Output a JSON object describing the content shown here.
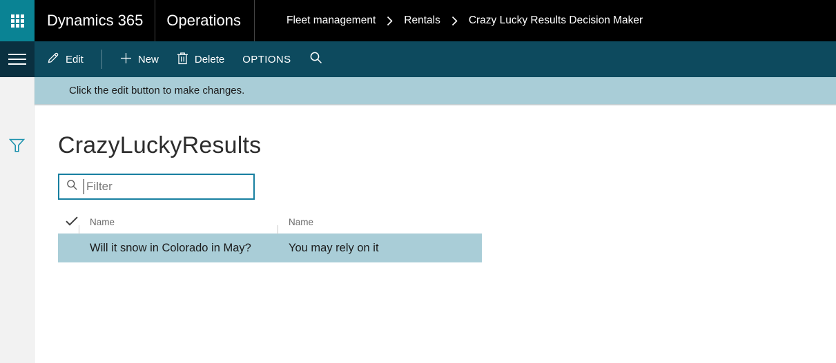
{
  "app": {
    "product": "Dynamics 365",
    "suite": "Operations"
  },
  "breadcrumb": {
    "items": [
      "Fleet management",
      "Rentals",
      "Crazy Lucky Results Decision Maker"
    ]
  },
  "toolbar": {
    "edit": "Edit",
    "new": "New",
    "delete": "Delete",
    "options": "OPTIONS"
  },
  "notification": {
    "message": "Click the edit button to make changes."
  },
  "page": {
    "title": "CrazyLuckyResults",
    "filter_placeholder": "Filter"
  },
  "grid": {
    "columns": [
      "Name",
      "Name"
    ],
    "rows": [
      {
        "name": "Will it snow in Colorado in May?",
        "value": "You may rely on it",
        "selected": true
      }
    ]
  },
  "icons": {
    "waffle-icon": "3x3-grid",
    "hamburger-icon": "≡",
    "edit-pencil-icon": "✎",
    "plus-icon": "+",
    "trash-icon": "🗑",
    "toolbar-search-icon": "🔍",
    "filter-funnel-icon": "⧩",
    "input-search-icon": "🔍",
    "select-all-checkmark-icon": "✓",
    "breadcrumb-chevron-icon": "›",
    "text-caret": "|"
  },
  "colors": {
    "topbar": "#000000",
    "brand_teal": "#0a8394",
    "toolbar": "#0d4a5e",
    "toolbar_nav_strip": "#0a3040",
    "notification": "#a9cdd7",
    "row_selection": "#a9cdd7",
    "filter_border": "#177fa0",
    "funnel_teal": "#1e93ae",
    "sidebar": "#f2f2f2"
  }
}
